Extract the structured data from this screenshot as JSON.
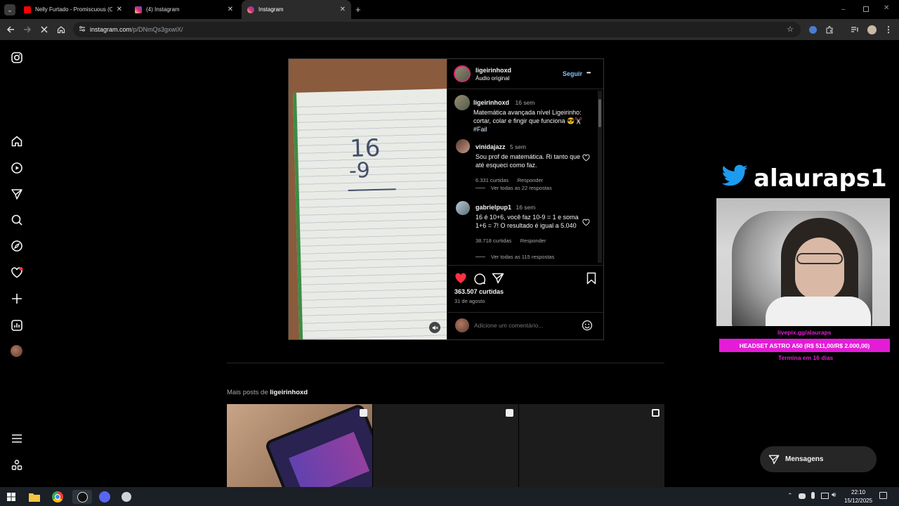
{
  "browser": {
    "tabs": [
      {
        "title": "Nelly Furtado - Promiscuous (O",
        "close": "✕",
        "favicon_color": "#ff0000"
      },
      {
        "title": "(4) Instagram",
        "close": "✕",
        "favicon_color": "#d6249f"
      },
      {
        "title": "Instagram",
        "close": "✕",
        "favicon_color": "#d6249f"
      }
    ],
    "new_tab": "+",
    "url_host": "instagram.com",
    "url_path": "/p/DNmQs3gxwiX/"
  },
  "post": {
    "username": "ligeirinhoxd",
    "audio": "Áudio original",
    "follow": "Seguir",
    "more": "•••",
    "caption": {
      "username": "ligeirinhoxd",
      "time": "16 sem",
      "text": "Matemática avançada nível Ligeirinho: cortar, colar e fingir que funciona 😎✂️",
      "hashtag": "#Fail"
    },
    "notebook": {
      "line1": "16",
      "line2": "-9"
    },
    "comments": [
      {
        "username": "vinidajazz",
        "time": "5 sem",
        "text": "Sou prof de matemática. Ri tanto que até esqueci como faz.",
        "likes": "6.331 curtidas",
        "reply": "Responder",
        "view_replies": "Ver todas as 22 respostas"
      },
      {
        "username": "gabrielpup1",
        "time": "16 sem",
        "text": "16 é 10+6, você faz 10-9 = 1 e soma 1+6 = 7! O resultado é igual a 5.040",
        "likes": "38.718 curtidas",
        "reply": "Responder",
        "view_replies": "Ver todas as 115 respostas"
      }
    ],
    "likes": "363.507 curtidas",
    "date": "31 de agosto",
    "add_comment_placeholder": "Adicione um comentário..."
  },
  "more_posts": {
    "prefix": "Mais posts de ",
    "username": "ligeirinhoxd"
  },
  "overlay": {
    "twitter_handle": "alauraps1",
    "livepix": "livepix.gg/alauraps",
    "goal": "HEADSET ASTRO A50 (R$ 511,00/R$ 2.000,00)",
    "ends": "Termina em 16 dias"
  },
  "messages_label": "Mensagens",
  "taskbar": {
    "time": "22:10",
    "date": "15/12/2025"
  },
  "colors": {
    "like_red": "#ff3040",
    "follow_blue": "#85c3ff",
    "goal_magenta": "#e41cd8",
    "twitter_blue": "#1d9bf0"
  }
}
